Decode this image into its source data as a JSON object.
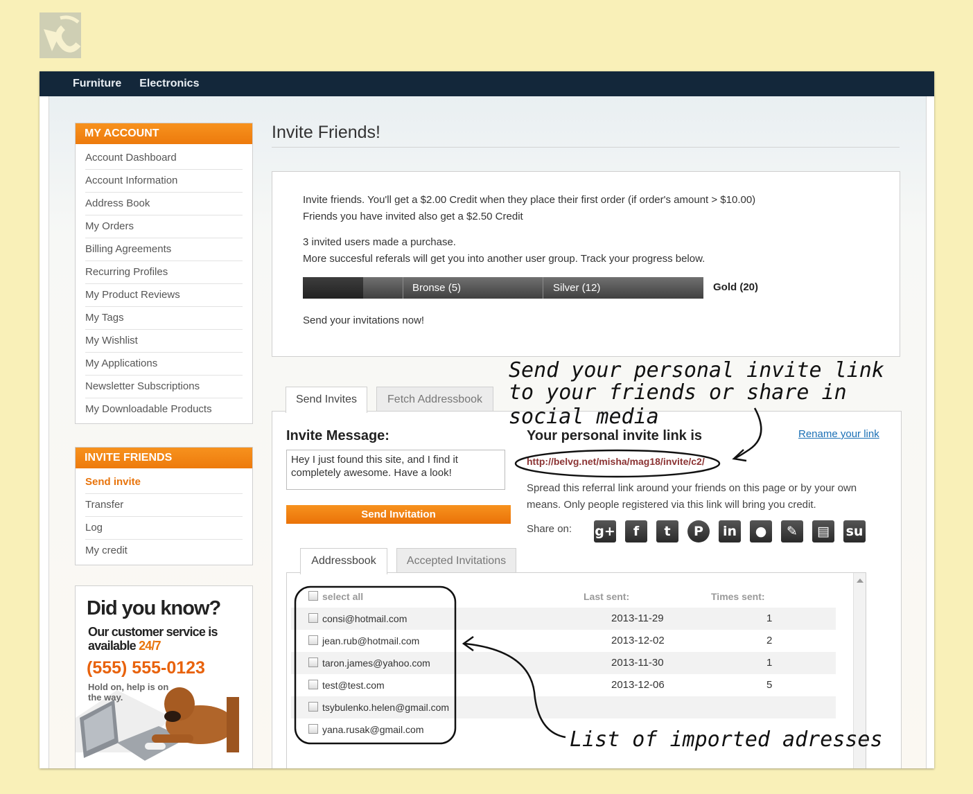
{
  "nav": {
    "items": [
      "Furniture",
      "Electronics"
    ]
  },
  "sidebar": {
    "my_account": {
      "title": "MY ACCOUNT",
      "items": [
        "Account Dashboard",
        "Account Information",
        "Address Book",
        "My Orders",
        "Billing Agreements",
        "Recurring Profiles",
        "My Product Reviews",
        "My Tags",
        "My Wishlist",
        "My Applications",
        "Newsletter Subscriptions",
        "My Downloadable Products"
      ]
    },
    "invite_friends": {
      "title": "INVITE FRIENDS",
      "items": [
        "Send invite",
        "Transfer",
        "Log",
        "My credit"
      ],
      "active": "Send invite"
    },
    "promo": {
      "heading": "Did you know?",
      "line1": "Our customer service is",
      "line2_prefix": "available ",
      "line2_highlight": "24/7",
      "phone": "(555) 555-0123",
      "note": "Hold on, help is on the way."
    }
  },
  "page_title": "Invite Friends!",
  "info": {
    "line1": "Invite friends. You'll get a $2.00 Credit when they place their first order (if order's amount > $10.00)",
    "line2": "Friends you have invited also get a $2.50 Credit",
    "line3": "3 invited users made a purchase.",
    "line4": "More succesful referals will get you into another user group. Track your progress below.",
    "progress_fraction": 0.15,
    "levels": [
      "Bronse (5)",
      "Silver (12)",
      "Gold (20)"
    ],
    "cta": "Send your invitations now!"
  },
  "tabs": [
    "Send Invites",
    "Fetch Addressbook"
  ],
  "invite": {
    "message_label": "Invite Message:",
    "message_text": "Hey I just found this site, and I find it completely awesome. Have a look!",
    "send_button": "Send Invitation",
    "link_label": "Your personal invite link is",
    "rename_link": "Rename your link",
    "link_url": "http://belvg.net/misha/mag18/invite/c2/",
    "spread_text": "Spread this referral link around your friends on this page or by your own means. Only people registered via this link will bring you credit.",
    "share_label": "Share on:",
    "share_icons": [
      "google-plus-icon",
      "facebook-icon",
      "twitter-icon",
      "pinterest-icon",
      "linkedin-icon",
      "myspace-icon",
      "blogger-icon",
      "delicious-icon",
      "stumbleupon-icon"
    ]
  },
  "list_tabs": [
    "Addressbook",
    "Accepted Invitations"
  ],
  "addressbook": {
    "select_all": "select all",
    "col_last_sent": "Last sent:",
    "col_times_sent": "Times sent:",
    "rows": [
      {
        "email": "consi@hotmail.com",
        "last_sent": "2013-11-29",
        "times": "1"
      },
      {
        "email": "jean.rub@hotmail.com",
        "last_sent": "2013-12-02",
        "times": "2"
      },
      {
        "email": "taron.james@yahoo.com",
        "last_sent": "2013-11-30",
        "times": "1"
      },
      {
        "email": "test@test.com",
        "last_sent": "2013-12-06",
        "times": "5"
      },
      {
        "email": "tsybulenko.helen@gmail.com",
        "last_sent": "",
        "times": ""
      },
      {
        "email": "yana.rusak@gmail.com",
        "last_sent": "",
        "times": ""
      }
    ]
  },
  "annotations": {
    "top_line1": "Send your personal invite link",
    "top_line2": "to your friends or share in social media",
    "bottom": "List of imported adresses"
  },
  "colors": {
    "accent": "#ee7d12",
    "nav_bg": "#13273a",
    "page_bg": "#f9f0b8",
    "link": "#1a6fb5"
  }
}
